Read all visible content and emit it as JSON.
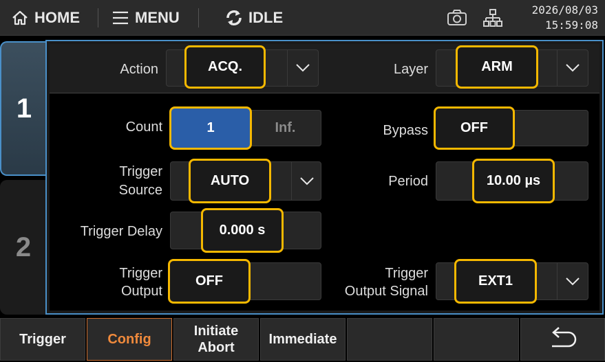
{
  "topbar": {
    "home_label": "HOME",
    "menu_label": "MENU",
    "status_label": "IDLE",
    "date": "2026/08/03",
    "time": "15:59:08"
  },
  "tabs": [
    {
      "label": "1",
      "active": true
    },
    {
      "label": "2",
      "active": false
    }
  ],
  "header": {
    "action_label": "Action",
    "action_value": "ACQ.",
    "layer_label": "Layer",
    "layer_value": "ARM"
  },
  "fields": {
    "count_label": "Count",
    "count_value": "1",
    "count_inf": "Inf.",
    "bypass_label": "Bypass",
    "bypass_value": "OFF",
    "trigger_source_label_1": "Trigger",
    "trigger_source_label_2": "Source",
    "trigger_source_value": "AUTO",
    "period_label": "Period",
    "period_value": "10.00 µs",
    "trigger_delay_label": "Trigger Delay",
    "trigger_delay_value": "0.000 s",
    "trigger_output_label_1": "Trigger",
    "trigger_output_label_2": "Output",
    "trigger_output_value": "OFF",
    "trigger_output_signal_label_1": "Trigger",
    "trigger_output_signal_label_2": "Output Signal",
    "trigger_output_signal_value": "EXT1"
  },
  "bottom": {
    "trigger": "Trigger",
    "config": "Config",
    "initiate": "Initiate",
    "abort": "Abort",
    "immediate": "Immediate"
  },
  "colors": {
    "accent_highlight": "#f5b800",
    "active_blue": "#2a5ea8",
    "panel_border": "#4a90c9",
    "active_softkey": "#f08a3c"
  }
}
